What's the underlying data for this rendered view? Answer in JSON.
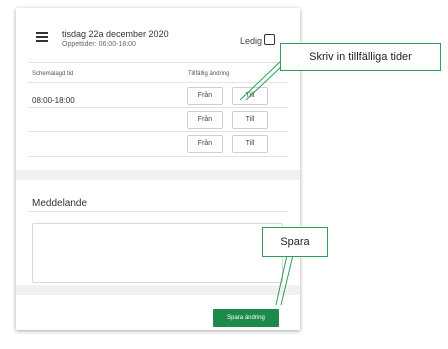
{
  "header": {
    "date": "tisdag 22a december 2020",
    "hours": "Öppettider: 06:00-18:00",
    "ledig_label": "Ledig"
  },
  "columns": {
    "scheduled": "Schemalagd tid",
    "temporary": "Tillfällig ändring"
  },
  "rows": [
    {
      "time": "08:00-18:00",
      "from_label": "Från",
      "to_label": "Till"
    },
    {
      "time": "",
      "from_label": "Från",
      "to_label": "Till"
    },
    {
      "time": "",
      "from_label": "Från",
      "to_label": "Till"
    }
  ],
  "message": {
    "title": "Meddelande",
    "value": ""
  },
  "save_button": {
    "label": "Spara ändring"
  },
  "callouts": {
    "temp_times": "Skriv in tillfälliga tider",
    "save": "Spara"
  },
  "colors": {
    "accent": "#1e8a4a",
    "callout_border": "#2aa05a"
  }
}
